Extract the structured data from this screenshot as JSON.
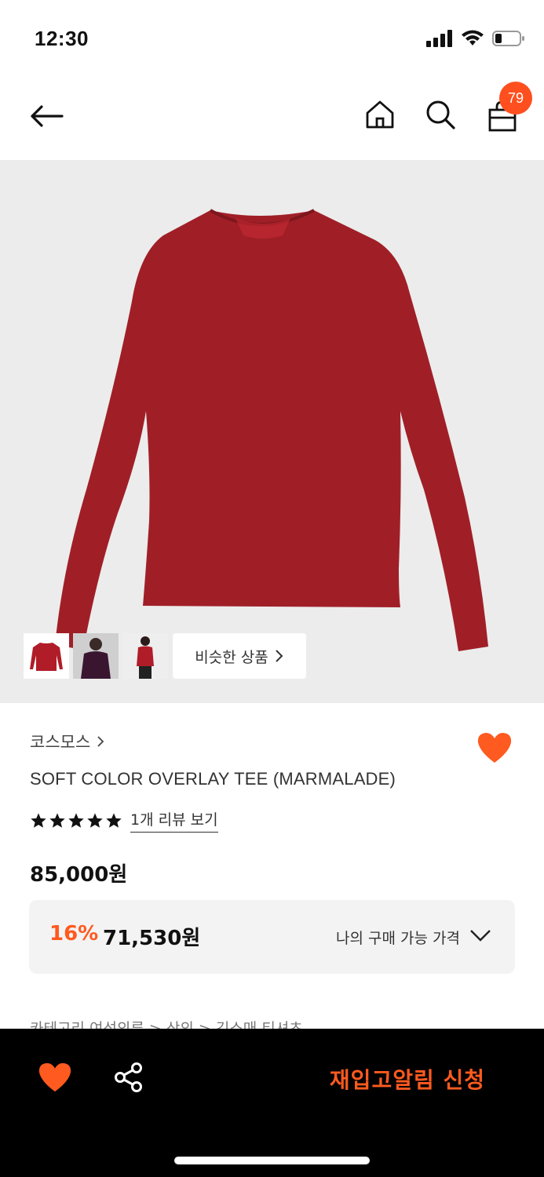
{
  "status": {
    "time": "12:30"
  },
  "nav": {
    "cart_count": "79"
  },
  "gallery": {
    "similar_label": "비슷한 상품"
  },
  "product": {
    "brand": "코스모스",
    "title": "SOFT COLOR OVERLAY TEE (MARMALADE)",
    "rating": 5,
    "review_link": "1개 리뷰 보기",
    "list_price": "85,000원",
    "discount_pct": "16%",
    "discount_price": "71,530원",
    "my_price_label": "나의 구매 가능 가격",
    "category_peek": "카테고리        여성의류  >  상의  >  긴소매 티셔츠"
  },
  "bottom_bar": {
    "restock_label": "재입고알림 신청"
  },
  "colors": {
    "accent": "#ff5a1f",
    "shirt": "#a01f27",
    "image_bg": "#ececec"
  }
}
